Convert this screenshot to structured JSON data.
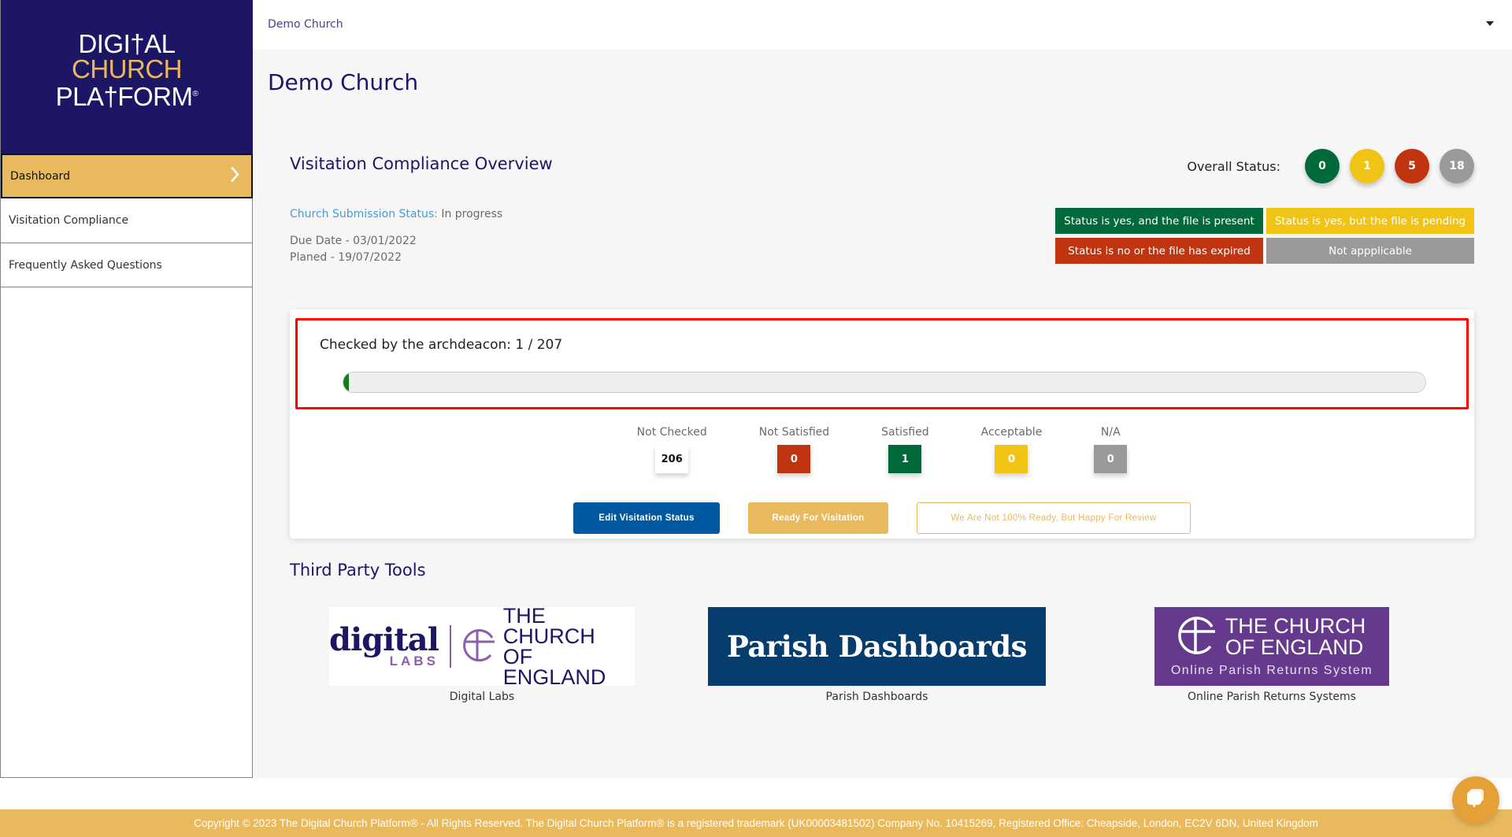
{
  "sidebar": {
    "logo": {
      "line1": "DIGI†AL",
      "line2": "CHURCH",
      "line3": "PLA†FORM",
      "reg": "®"
    },
    "items": [
      {
        "label": "Dashboard",
        "active": true
      },
      {
        "label": "Visitation Compliance",
        "active": false
      },
      {
        "label": "Frequently Asked Questions",
        "active": false
      }
    ],
    "chevron_icon": "chevron-right-icon"
  },
  "topbar": {
    "church_name": "Demo Church",
    "dropdown_icon": "caret-down-icon"
  },
  "page": {
    "title": "Demo Church"
  },
  "overview": {
    "title": "Visitation Compliance Overview",
    "submission_label": "Church Submission Status:",
    "submission_value": "In progress",
    "due_date": "Due Date - 03/01/2022",
    "planned": "Planed - 19/07/2022",
    "overall_label": "Overall Status:",
    "overall_counts": [
      {
        "value": "0",
        "color": "#016a3a"
      },
      {
        "value": "1",
        "color": "#f0c414"
      },
      {
        "value": "5",
        "color": "#c0350f"
      },
      {
        "value": "18",
        "color": "#9a9a9a"
      }
    ],
    "legend": [
      {
        "label": "Status is yes, and the file is present",
        "color": "#016a3a"
      },
      {
        "label": "Status is yes, but the file is pending",
        "color": "#f0c414"
      },
      {
        "label": "Status is no or the file has expired",
        "color": "#c0350f"
      },
      {
        "label": "Not appplicable",
        "color": "#9a9a9a"
      }
    ]
  },
  "progress": {
    "label": "Checked by the archdeacon: 1 / 207",
    "checked": 1,
    "total": 207,
    "fill_color": "#157a1b"
  },
  "stats": [
    {
      "label": "Not Checked",
      "value": "206",
      "bg": "#ffffff",
      "fg": "#111111"
    },
    {
      "label": "Not Satisfied",
      "value": "0",
      "bg": "#c0350f",
      "fg": "#ffffff"
    },
    {
      "label": "Satisfied",
      "value": "1",
      "bg": "#016a3a",
      "fg": "#ffffff"
    },
    {
      "label": "Acceptable",
      "value": "0",
      "bg": "#f0c414",
      "fg": "#ffffff"
    },
    {
      "label": "N/A",
      "value": "0",
      "bg": "#9a9a9a",
      "fg": "#ffffff"
    }
  ],
  "actions": {
    "edit": "Edit Visitation Status",
    "ready": "Ready For Visitation",
    "review": "We Are Not 100% Ready, But Happy For Review"
  },
  "tools": {
    "title": "Third Party Tools",
    "items": [
      {
        "caption": "Digital Labs",
        "logo_digital": "digital",
        "logo_labs": "LABS",
        "logo_coe": "THE CHURCH\nOF ENGLAND"
      },
      {
        "caption": "Parish Dashboards",
        "logo_text": "Parish Dashboards"
      },
      {
        "caption": "Online Parish Returns Systems",
        "logo_coe": "THE CHURCH\nOF ENGLAND",
        "logo_sub": "Online Parish Returns System"
      }
    ]
  },
  "footer": {
    "text": "Copyright © 2023 The Digital Church Platform® - All Rights Reserved. The Digital Church Platform® is a registered trademark (UK00003481502) Company No. 10415269, Registered Office: Cheapside, London, EC2V 6DN, United Kingdom"
  },
  "chat": {
    "icon": "chat-bubbles-icon"
  }
}
